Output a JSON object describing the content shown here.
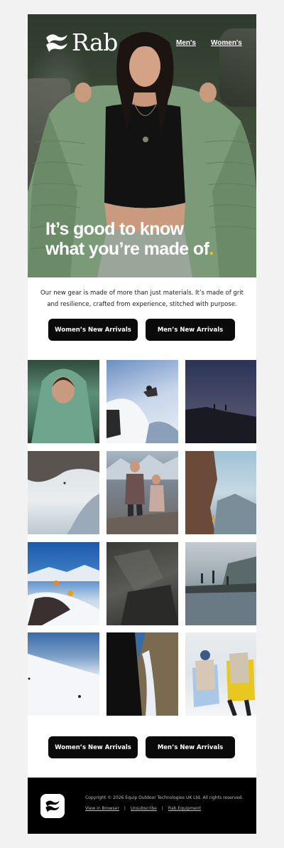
{
  "header": {
    "brand": "Rab",
    "nav": [
      {
        "label": "Men's"
      },
      {
        "label": "Women's"
      }
    ]
  },
  "hero": {
    "headline_line1": "It’s good to know",
    "headline_line2": "what you’re made of",
    "headline_dot": ".",
    "accent_color": "#f3c214"
  },
  "intro": {
    "text": "Our new gear is made of more than just materials. It’s made of grit and resilience, crafted from experience, stitched with purpose."
  },
  "cta_top": {
    "womens": "Women’s New Arrivals",
    "mens": "Men’s New Arrivals"
  },
  "cta_bottom": {
    "womens": "Women’s New Arrivals",
    "mens": "Men’s New Arrivals"
  },
  "gallery": {
    "images": [
      "woman-in-hood-photo",
      "skier-jump-photo",
      "hikers-ridge-dusk-photo",
      "snow-slope-climber-photo",
      "couple-hiking-photo",
      "rock-climber-cliff-photo",
      "alpine-climbers-photo",
      "dark-rock-photo",
      "hikers-crossing-pool-photo",
      "snow-ridge-skier-photo",
      "ice-gully-photo",
      "backpackers-snow-photo"
    ]
  },
  "footer": {
    "copyright": "Copyright © 2026 Equip Outdoor Technologies UK Ltd. All rights reserved.",
    "links": [
      {
        "label": "View in Browser"
      },
      {
        "label": "Unsubscribe"
      },
      {
        "label": "Rab.Equipment"
      }
    ],
    "separator": "|"
  },
  "colors": {
    "background": "#f2f2f2",
    "button": "#0a0a0a",
    "footer": "#000000"
  }
}
